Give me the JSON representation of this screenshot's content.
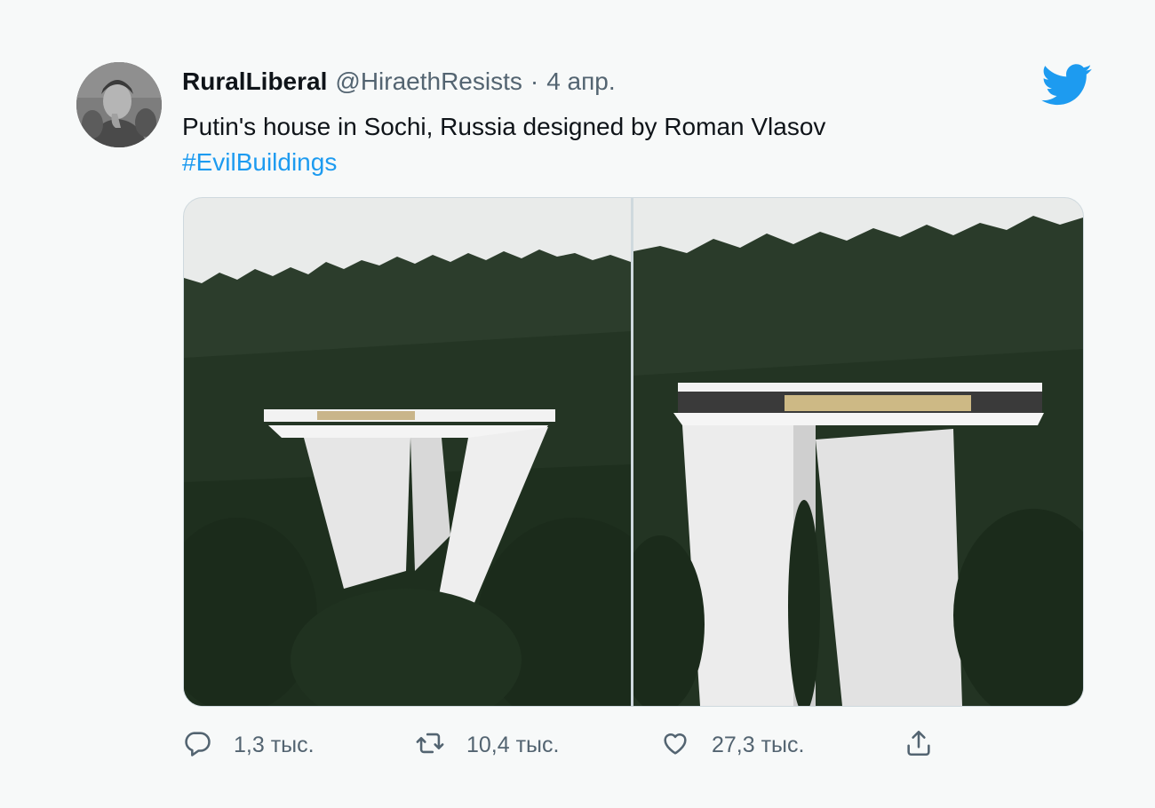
{
  "tweet": {
    "display_name": "RuralLiberal",
    "handle": "@HiraethResists",
    "separator": "·",
    "date": "4 апр.",
    "text": "Putin's house in Sochi, Russia designed by Roman Vlasov",
    "hashtag": "#EvilBuildings"
  },
  "icons": {
    "avatar": "avatar-photo",
    "brand": "twitter-bird-icon",
    "reply": "speech-bubble-icon",
    "retweet": "retweet-arrows-icon",
    "like": "heart-icon",
    "share": "share-upload-icon"
  },
  "actions": {
    "reply_count": "1,3 тыс.",
    "retweet_count": "10,4 тыс.",
    "like_count": "27,3 тыс."
  },
  "colors": {
    "background": "#f7f9f9",
    "text": "#0f1419",
    "secondary": "#536471",
    "link": "#1d9bf0",
    "brand": "#1d9bf0"
  }
}
